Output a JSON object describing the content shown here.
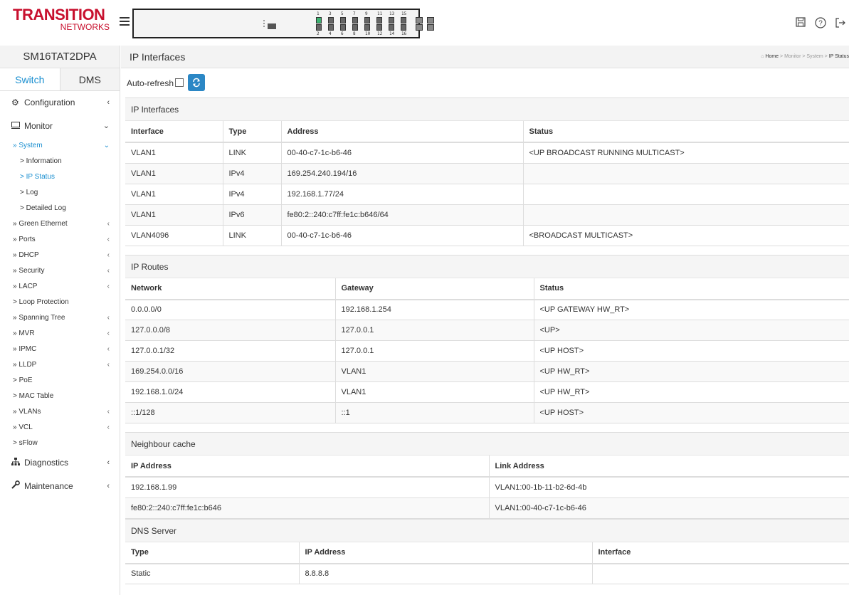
{
  "logo": {
    "main": "TRANSITION",
    "sub": "NETWORKS"
  },
  "top_icons": [
    "save-icon",
    "help-icon",
    "logout-icon"
  ],
  "port_labels": {
    "top": [
      "1",
      "3",
      "5",
      "7",
      "9",
      "11",
      "13",
      "15"
    ],
    "bottom": [
      "2",
      "4",
      "6",
      "8",
      "10",
      "12",
      "14",
      "16"
    ]
  },
  "sidebar": {
    "model": "SM16TAT2DPA",
    "tabs": [
      "Switch",
      "DMS"
    ],
    "configuration": "Configuration",
    "monitor": "Monitor",
    "system": "» System",
    "system_items": [
      "> Information",
      "> IP Status",
      "> Log",
      "> Detailed Log"
    ],
    "monitor_items": [
      {
        "label": "» Green Ethernet",
        "arrow": true
      },
      {
        "label": "» Ports",
        "arrow": true
      },
      {
        "label": "» DHCP",
        "arrow": true
      },
      {
        "label": "» Security",
        "arrow": true
      },
      {
        "label": "» LACP",
        "arrow": true
      },
      {
        "label": "> Loop Protection",
        "arrow": false
      },
      {
        "label": "» Spanning Tree",
        "arrow": true
      },
      {
        "label": "» MVR",
        "arrow": true
      },
      {
        "label": "» IPMC",
        "arrow": true
      },
      {
        "label": "» LLDP",
        "arrow": true
      },
      {
        "label": "> PoE",
        "arrow": false
      },
      {
        "label": "> MAC Table",
        "arrow": false
      },
      {
        "label": "» VLANs",
        "arrow": true
      },
      {
        "label": "» VCL",
        "arrow": true
      },
      {
        "label": "> sFlow",
        "arrow": false
      }
    ],
    "diagnostics": "Diagnostics",
    "maintenance": "Maintenance"
  },
  "page": {
    "title": "IP Interfaces",
    "breadcrumb": [
      "Home",
      "Monitor",
      "System",
      "IP Status"
    ],
    "auto_refresh_label": "Auto-refresh"
  },
  "ip_interfaces": {
    "title": "IP Interfaces",
    "headers": [
      "Interface",
      "Type",
      "Address",
      "Status"
    ],
    "rows": [
      [
        "VLAN1",
        "LINK",
        "00-40-c7-1c-b6-46",
        "<UP BROADCAST RUNNING MULTICAST>"
      ],
      [
        "VLAN1",
        "IPv4",
        "169.254.240.194/16",
        ""
      ],
      [
        "VLAN1",
        "IPv4",
        "192.168.1.77/24",
        ""
      ],
      [
        "VLAN1",
        "IPv6",
        "fe80:2::240:c7ff:fe1c:b646/64",
        ""
      ],
      [
        "VLAN4096",
        "LINK",
        "00-40-c7-1c-b6-46",
        "<BROADCAST MULTICAST>"
      ]
    ]
  },
  "ip_routes": {
    "title": "IP Routes",
    "headers": [
      "Network",
      "Gateway",
      "Status"
    ],
    "rows": [
      [
        "0.0.0.0/0",
        "192.168.1.254",
        "<UP GATEWAY HW_RT>"
      ],
      [
        "127.0.0.0/8",
        "127.0.0.1",
        "<UP>"
      ],
      [
        "127.0.0.1/32",
        "127.0.0.1",
        "<UP HOST>"
      ],
      [
        "169.254.0.0/16",
        "VLAN1",
        "<UP HW_RT>"
      ],
      [
        "192.168.1.0/24",
        "VLAN1",
        "<UP HW_RT>"
      ],
      [
        "::1/128",
        "::1",
        "<UP HOST>"
      ]
    ]
  },
  "neighbour_cache": {
    "title": "Neighbour cache",
    "headers": [
      "IP Address",
      "Link Address"
    ],
    "rows": [
      [
        "192.168.1.99",
        "VLAN1:00-1b-11-b2-6d-4b"
      ],
      [
        "fe80:2::240:c7ff:fe1c:b646",
        "VLAN1:00-40-c7-1c-b6-46"
      ]
    ]
  },
  "dns_server": {
    "title": "DNS Server",
    "headers": [
      "Type",
      "IP Address",
      "Interface"
    ],
    "rows": [
      [
        "Static",
        "8.8.8.8",
        ""
      ]
    ]
  }
}
